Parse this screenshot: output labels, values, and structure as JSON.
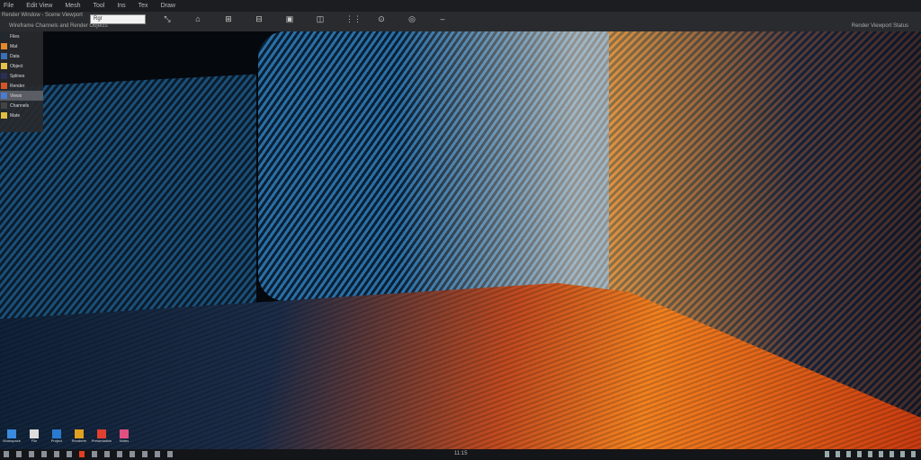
{
  "menubar": {
    "items": [
      "File",
      "Edit View",
      "Mesh",
      "Tool",
      "Ins",
      "Tex",
      "Draw"
    ]
  },
  "toolbar": {
    "title": "Render Window - Scene Viewport",
    "subtitle": "Wireframe Channels and Render Objects",
    "search_value": "Rgr",
    "right_status": "Render Viewport Status"
  },
  "tools": [
    "select",
    "move",
    "scale",
    "snap",
    "frame",
    "render",
    "grid",
    "view",
    "camera",
    "more"
  ],
  "panel": {
    "items": [
      {
        "label": "Files",
        "color": "#1f2a2e"
      },
      {
        "label": "Mat",
        "color": "#e6892a"
      },
      {
        "label": "Data",
        "color": "#3b6fb5"
      },
      {
        "label": "Object",
        "color": "#e5c04a"
      },
      {
        "label": "Splines",
        "color": "#2a2f55"
      },
      {
        "label": "Render",
        "color": "#d4552a"
      },
      {
        "label": "Views",
        "color": "#4a7bd0",
        "selected": true
      },
      {
        "label": "Channels",
        "color": "#444"
      },
      {
        "label": "Mate",
        "color": "#e0c040"
      }
    ]
  },
  "desktop": [
    {
      "label": "Workspace",
      "color": "#3a8ae0"
    },
    {
      "label": "File",
      "color": "#dddddd"
    },
    {
      "label": "Project",
      "color": "#2a7ad0"
    },
    {
      "label": "Renderer",
      "color": "#e0a020"
    },
    {
      "label": "Presentation",
      "color": "#e04030"
    },
    {
      "label": "Notes",
      "color": "#e05080"
    }
  ],
  "taskbar": {
    "clock": "11:15",
    "task_count": 14,
    "tray_count": 9
  }
}
